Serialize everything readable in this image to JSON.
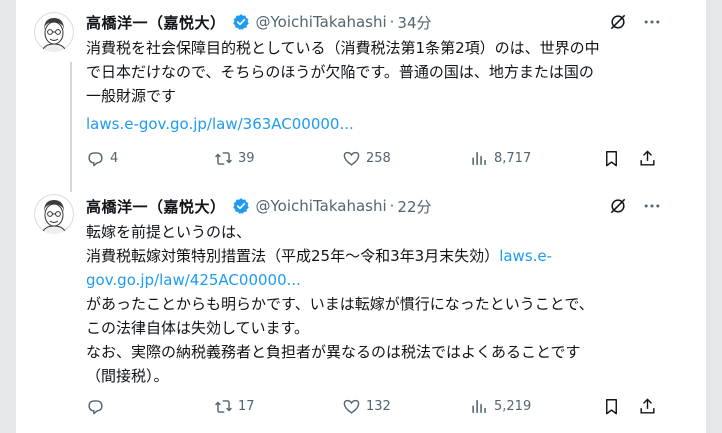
{
  "tweets": [
    {
      "author": {
        "name": "高橋洋一（嘉悦大）",
        "handle": "@YoichiTakahashi",
        "separator": "·",
        "time": "34分"
      },
      "lines": [
        {
          "text": "消費税を社会保障目的税としている（消費税法第1条第2項）のは、世界の中"
        },
        {
          "text": "で日本だけなので、そちらのほうが欠陥です。普通の国は、地方または国の"
        },
        {
          "text": "一般財源です"
        },
        {
          "text": "",
          "link": "laws.e-gov.go.jp/law/363AC00000..."
        }
      ],
      "stats": {
        "replies": "4",
        "reposts": "39",
        "likes": "258",
        "views": "8,717"
      }
    },
    {
      "author": {
        "name": "高橋洋一（嘉悦大）",
        "handle": "@YoichiTakahashi",
        "separator": "·",
        "time": "22分"
      },
      "lines": [
        {
          "text": "転嫁を前提というのは、"
        },
        {
          "text": "消費税転嫁対策特別措置法（平成25年～令和3年3月末失効）",
          "link": "laws.e-"
        },
        {
          "text": "",
          "link": "gov.go.jp/law/425AC00000..."
        },
        {
          "text": "があったことからも明らかです、いまは転嫁が慣行になったということで、"
        },
        {
          "text": "この法律自体は失効しています。"
        },
        {
          "text": "なお、実際の納税義務者と負担者が異なるのは税法ではよくあることです"
        },
        {
          "text": "（間接税）。"
        }
      ],
      "stats": {
        "replies": "",
        "reposts": "17",
        "likes": "132",
        "views": "5,219"
      }
    }
  ],
  "colors": {
    "text": "#0f1419",
    "secondary": "#536471",
    "link": "#1d9bf0",
    "verified": "#1d9bf0",
    "frame": "#e4e6e9"
  },
  "icons": [
    "avatar-caricature",
    "verified-badge-icon",
    "grok-icon",
    "more-icon",
    "reply-icon",
    "repost-icon",
    "like-icon",
    "views-icon",
    "bookmark-icon",
    "share-icon"
  ]
}
